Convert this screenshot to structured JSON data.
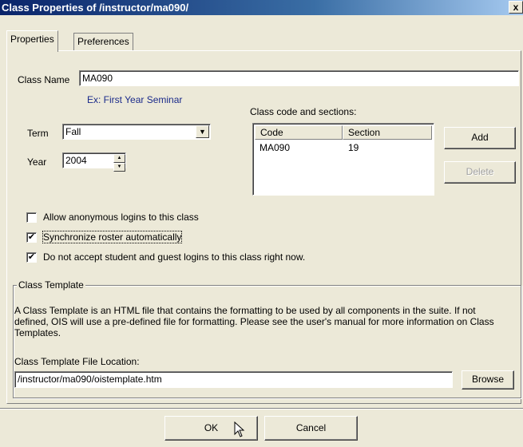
{
  "window": {
    "title": "Class Properties of /instructor/ma090/",
    "close_label": "x"
  },
  "tabs": [
    {
      "label": "Properties",
      "active": true
    },
    {
      "label": "Preferences",
      "active": false
    }
  ],
  "class_name": {
    "label": "Class Name",
    "value": "MA090",
    "hint": "Ex: First Year Seminar"
  },
  "term": {
    "label": "Term",
    "value": "Fall",
    "arrow": "▼"
  },
  "year": {
    "label": "Year",
    "value": "2004",
    "up": "▲",
    "down": "▼"
  },
  "sections": {
    "label": "Class code and sections:",
    "columns": [
      "Code",
      "Section"
    ],
    "rows": [
      {
        "code": "MA090",
        "section": "19"
      }
    ],
    "add_label": "Add",
    "delete_label": "Delete"
  },
  "options": [
    {
      "label": "Allow anonymous logins to this class",
      "checked": false,
      "mark": ""
    },
    {
      "label": "Synchronize roster automatically",
      "checked": true,
      "mark": "✔"
    },
    {
      "label": "Do not accept student and guest logins to this class right now.",
      "checked": true,
      "mark": "✔"
    }
  ],
  "template": {
    "legend": "Class Template",
    "description": "A Class Template is an HTML file that contains the formatting to be used by all components in the suite. If not defined, OIS will use a pre-defined file for formatting. Please see the user's manual for more information on Class Templates.",
    "file_label": "Class Template File Location:",
    "file_value": "/instructor/ma090/oistemplate.htm",
    "browse_label": "Browse"
  },
  "footer": {
    "ok_label": "OK",
    "cancel_label": "Cancel"
  },
  "colors": {
    "titlebar": "#0a246a",
    "face": "#ece9d8",
    "hint": "#1a2a8a"
  }
}
